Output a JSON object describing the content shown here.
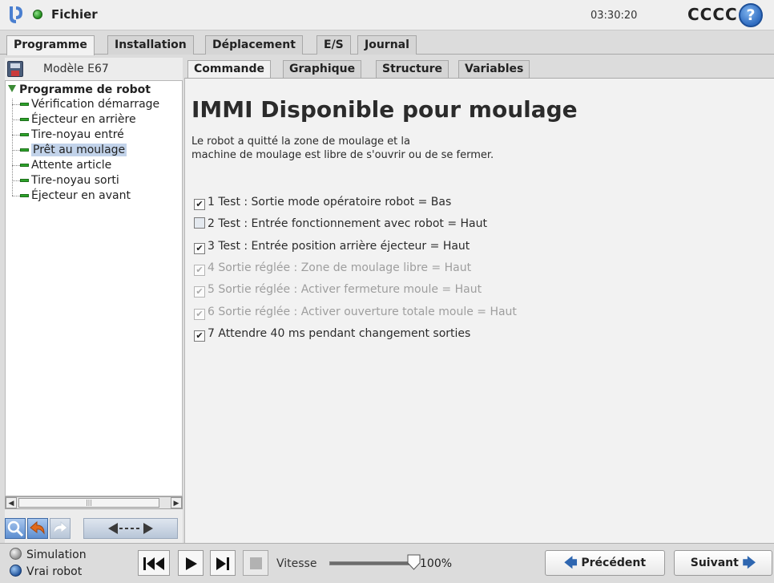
{
  "header": {
    "file_menu": "Fichier",
    "clock": "03:30:20",
    "robot_name": "CCCC",
    "help_glyph": "?"
  },
  "main_tabs": [
    "Programme",
    "Installation",
    "Déplacement",
    "E/S",
    "Journal"
  ],
  "active_main_tab": "Programme",
  "left": {
    "model": "Modèle E67",
    "tree_root": "Programme de robot",
    "tree_items": [
      "Vérification démarrage",
      "Éjecteur en arrière",
      "Tire-noyau entré",
      "Prêt au moulage",
      "Attente article",
      "Tire-noyau sorti",
      "Éjecteur en avant"
    ],
    "selected_item": "Prêt au moulage",
    "scroll_grip": "|||"
  },
  "sub_tabs": [
    "Commande",
    "Graphique",
    "Structure",
    "Variables"
  ],
  "active_sub_tab": "Commande",
  "node": {
    "title": "IMMI Disponible pour moulage",
    "description_line1": "Le robot a quitté la zone de moulage et la",
    "description_line2": "machine de moulage est libre de s'ouvrir ou de se fermer.",
    "checks": [
      {
        "label": "1 Test : Sortie mode opératoire robot = Bas",
        "checked": true,
        "enabled": true
      },
      {
        "label": "2 Test : Entrée fonctionnement avec robot = Haut",
        "checked": false,
        "enabled": true
      },
      {
        "label": "3 Test : Entrée position arrière éjecteur = Haut",
        "checked": true,
        "enabled": true
      },
      {
        "label": "4 Sortie réglée : Zone de moulage libre = Haut",
        "checked": true,
        "enabled": false
      },
      {
        "label": "5 Sortie réglée : Activer fermeture moule = Haut",
        "checked": true,
        "enabled": false
      },
      {
        "label": "6 Sortie réglée : Activer ouverture totale moule = Haut",
        "checked": true,
        "enabled": false
      },
      {
        "label": "7 Attendre 40 ms pendant changement sorties",
        "checked": true,
        "enabled": true
      }
    ]
  },
  "bottom": {
    "mode_simulation": "Simulation",
    "mode_real": "Vrai robot",
    "speed_label": "Vitesse",
    "speed_value": "100%",
    "speed_fraction": 1.0,
    "prev_label": "Précédent",
    "next_label": "Suivant"
  },
  "colors": {
    "status_ok": "#2da42a",
    "accent_blue": "#2e66b0",
    "selection": "#c2d3ea"
  }
}
